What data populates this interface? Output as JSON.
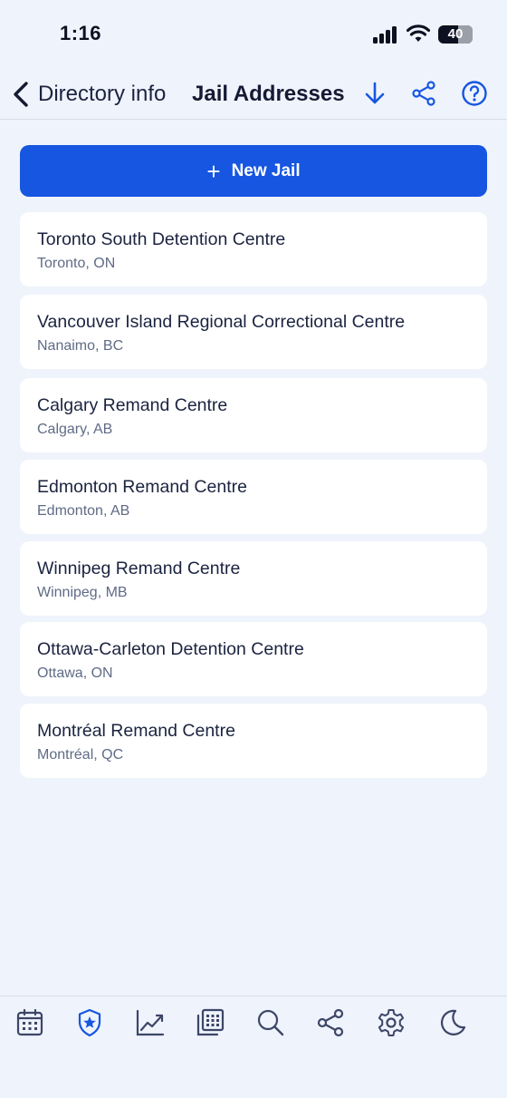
{
  "status_bar": {
    "time": "1:16",
    "battery": "40"
  },
  "nav": {
    "back_label": "Directory info",
    "title": "Jail Addresses"
  },
  "actions": {
    "new_jail_label": "New Jail",
    "new_jail_icon": "+"
  },
  "jails": [
    {
      "name": "Toronto South Detention Centre",
      "location": "Toronto, ON"
    },
    {
      "name": "Vancouver Island Regional Correctional Centre",
      "location": "Nanaimo, BC"
    },
    {
      "name": "Calgary Remand Centre",
      "location": "Calgary, AB"
    },
    {
      "name": "Edmonton Remand Centre",
      "location": "Edmonton, AB"
    },
    {
      "name": "Winnipeg Remand Centre",
      "location": "Winnipeg, MB"
    },
    {
      "name": "Ottawa-Carleton Detention Centre",
      "location": "Ottawa, ON"
    },
    {
      "name": "Montréal Remand Centre",
      "location": "Montréal, QC"
    }
  ],
  "tab_bar": {
    "items": [
      "calendar-icon",
      "shield-star-icon",
      "trend-chart-icon",
      "grid-copy-icon",
      "search-icon",
      "share-icon",
      "settings-gear-icon",
      "moon-icon"
    ],
    "active": "shield-star-icon"
  },
  "colors": {
    "accent": "#1656e0",
    "background": "#eff3fb",
    "card": "#ffffff",
    "text_primary": "#1b2340",
    "text_secondary": "#5f6b86",
    "tab_icon": "#3c4668"
  }
}
